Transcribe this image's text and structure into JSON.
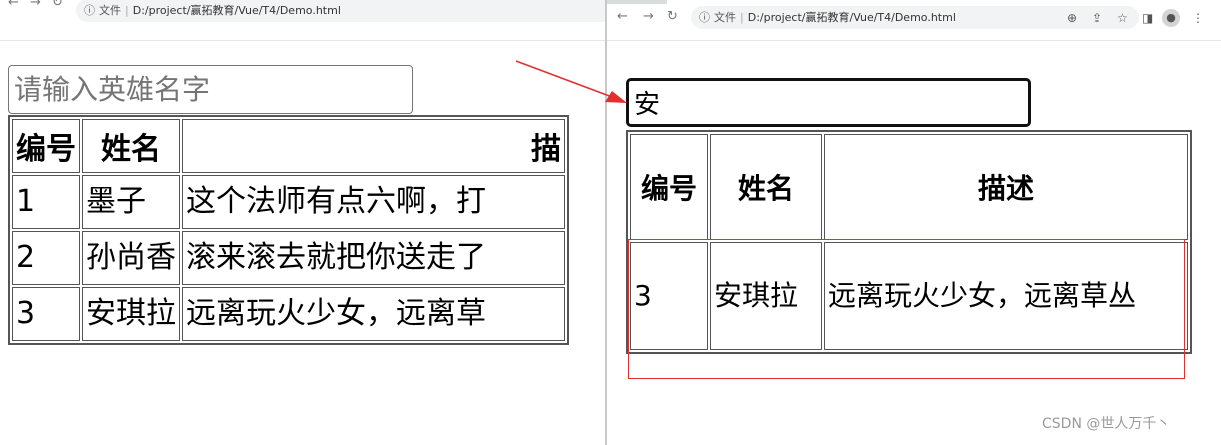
{
  "left": {
    "url_file_label": "文件",
    "url_path": "D:/project/赢拓教育/Vue/T4/Demo.html",
    "search": {
      "placeholder": "请输入英雄名字",
      "value": ""
    },
    "table": {
      "headers": [
        "编号",
        "姓名",
        "描"
      ],
      "rows": [
        [
          "1",
          "墨子",
          "这个法师有点六啊，打"
        ],
        [
          "2",
          "孙尚香",
          "滚来滚去就把你送走了"
        ],
        [
          "3",
          "安琪拉",
          "远离玩火少女，远离草"
        ]
      ]
    }
  },
  "right": {
    "url_file_label": "文件",
    "url_path": "D:/project/赢拓教育/Vue/T4/Demo.html",
    "search": {
      "value": "安"
    },
    "table": {
      "headers": [
        "编号",
        "姓名",
        "描述"
      ],
      "rows": [
        [
          "3",
          "安琪拉",
          "远离玩火少女，远离草丛"
        ]
      ]
    }
  },
  "watermark": "CSDN @世人万千丶",
  "colors": {
    "annotation": "#e03030"
  }
}
